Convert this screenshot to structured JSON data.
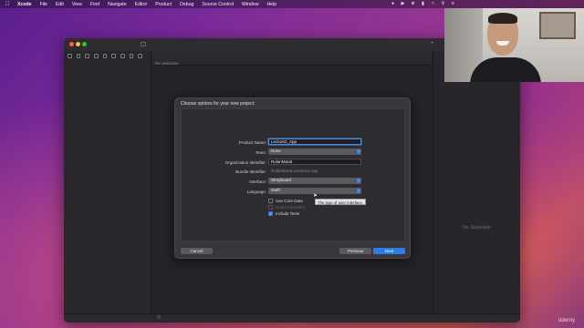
{
  "menubar": {
    "apple_icon": "apple-icon",
    "app_name": "Xcode",
    "items": [
      "File",
      "Edit",
      "View",
      "Find",
      "Navigate",
      "Editor",
      "Product",
      "Debug",
      "Source Control",
      "Window",
      "Help"
    ],
    "status_icons": [
      "record-icon",
      "play-icon",
      "bluetooth-icon",
      "battery-icon",
      "wifi-icon",
      "search-icon",
      "control-center-icon"
    ]
  },
  "editor": {
    "path_text": "No Selection"
  },
  "inspector": {
    "no_selection": "No Selection"
  },
  "sheet": {
    "title": "Choose options for your new project:",
    "product_name_label": "Product Name:",
    "product_name_value": "Lecture2_App",
    "team_label": "Team:",
    "team_value": "None",
    "org_id_label": "Organization Identifier:",
    "org_id_value": "RolanMarat",
    "bundle_id_label": "Bundle Identifier:",
    "bundle_id_value": "RolanMarat.Lecture2-App",
    "interface_label": "Interface:",
    "interface_value": "Storyboard",
    "language_label": "Language:",
    "language_value": "Swift",
    "tooltip": "The type of user interface.",
    "use_core_data": "Use Core Data",
    "host_in_cloudkit": "Host in CloudKit",
    "include_tests": "Include Tests",
    "cancel": "Cancel",
    "previous": "Previous",
    "next": "Next"
  },
  "watermark": "ûdemy"
}
